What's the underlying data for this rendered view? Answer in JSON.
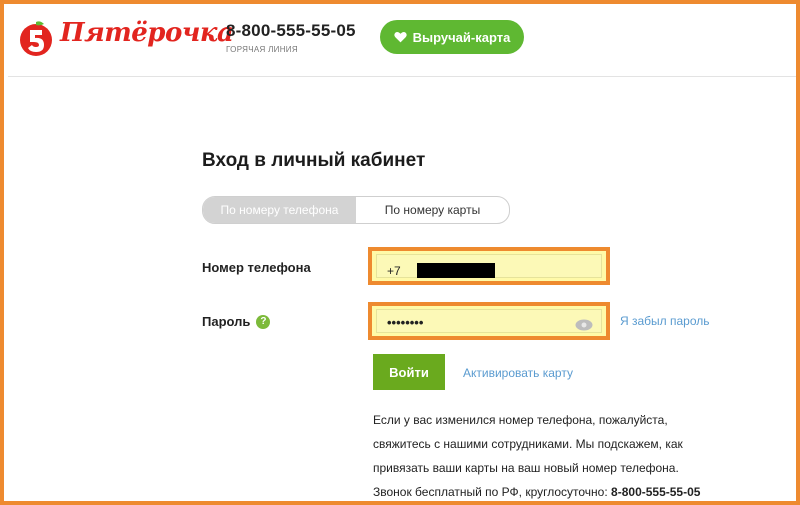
{
  "header": {
    "brand": "Пятёрочка",
    "hotline_phone": "8-800-555-55-05",
    "hotline_caption": "ГОРЯЧАЯ ЛИНИЯ",
    "card_button": "Выручай-карта"
  },
  "login": {
    "title": "Вход в личный кабинет",
    "tabs": [
      {
        "label": "По номеру телефона",
        "active": true
      },
      {
        "label": "По номеру карты",
        "active": false
      }
    ],
    "phone_label": "Номер телефона",
    "phone_prefix": "+7",
    "password_label": "Пароль",
    "help_icon_text": "?",
    "password_value": "••••••••",
    "forgot_link": "Я забыл пароль",
    "submit_button": "Войти",
    "activate_link": "Активировать карту"
  },
  "info": {
    "line1": "Если у вас изменился номер телефона, пожалуйста,",
    "line2": "свяжитесь с нашими сотрудниками. Мы подскажем, как",
    "line3": "привязать ваши карты на ваш новый номер телефона.",
    "line4": "Звонок бесплатный по РФ, круглосуточно:",
    "line4_phone": "8-800-555-55-05"
  },
  "colors": {
    "brand_red": "#e2251f",
    "accent_green": "#5fb832",
    "button_green": "#6aaa1e",
    "highlight_orange": "#ee8a2f",
    "field_yellow": "#fcf9b7",
    "link_blue": "#5a9bd0"
  },
  "icons": {
    "logo": "pyaterochka-logo-icon",
    "heart": "heart-icon",
    "help": "question-icon",
    "eye": "eye-icon"
  }
}
